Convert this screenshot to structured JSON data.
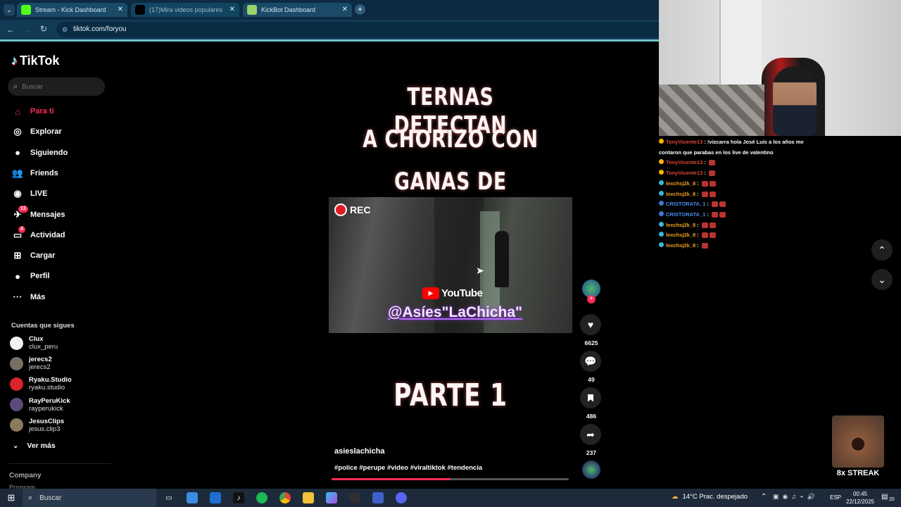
{
  "browser": {
    "tabs": [
      {
        "label": "Stream - Kick Dashboard",
        "fav_color": "#53fc18",
        "active": false
      },
      {
        "label": "(17)Mira videos populares",
        "fav_color": "#000000",
        "active": true
      },
      {
        "label": "KickBot Dashboard",
        "fav_color": "#9ad36a",
        "active": false
      }
    ],
    "url": "tiktok.com/foryou",
    "new_tab_symbol": "+"
  },
  "tiktok": {
    "logo": "TikTok",
    "search_placeholder": "Buscar",
    "nav": [
      {
        "label": "Para ti",
        "icon": "home-icon",
        "active": true
      },
      {
        "label": "Explorar",
        "icon": "compass-icon"
      },
      {
        "label": "Siguiendo",
        "icon": "following-avatar-icon"
      },
      {
        "label": "Friends",
        "icon": "friends-icon"
      },
      {
        "label": "LIVE",
        "icon": "live-icon"
      },
      {
        "label": "Mensajes",
        "icon": "messages-icon",
        "badge": "13"
      },
      {
        "label": "Actividad",
        "icon": "activity-icon",
        "badge": "4"
      },
      {
        "label": "Cargar",
        "icon": "upload-icon"
      },
      {
        "label": "Perfil",
        "icon": "profile-icon"
      },
      {
        "label": "Más",
        "icon": "more-icon"
      }
    ],
    "following_header": "Cuentas que sigues",
    "following": [
      {
        "name": "Clux",
        "handle": "clux_peru",
        "color": "#f2f2f2"
      },
      {
        "name": "jerecs2",
        "handle": "jerecs2",
        "color": "#7a6e62"
      },
      {
        "name": "Ryaku.Studio",
        "handle": "ryaku.studio",
        "color": "#d9222a"
      },
      {
        "name": "RayPeruKick",
        "handle": "rayperukick",
        "color": "#5b4a7a"
      },
      {
        "name": "JesusClips",
        "handle": "jesus.clip3",
        "color": "#8a7a5e"
      }
    ],
    "see_more": "Ver más",
    "footer_company": "Company",
    "footer_program": "Program"
  },
  "video": {
    "title_lines": [
      "TERNAS DETECTAN",
      "A CHORIZO CON",
      "GANAS DE CHOREAR"
    ],
    "rec_label": "REC",
    "youtube_label": "YouTube",
    "channel_handle": "@Asíes\"LaChicha\"",
    "part_label": "PARTE 1",
    "author": "asieslachicha",
    "hashtags": "#police #perupe #video #viraltiktok #tendencia",
    "progress": 0.5,
    "likes": "6625",
    "comments": "49",
    "saves": "486",
    "shares": "237"
  },
  "chat": [
    {
      "user": "TonyVicente13",
      "color": "#e0443a",
      "badge": "#ffb400",
      "msg": "!vizcarra hola José Luis a los años me"
    },
    {
      "user": "",
      "color": "#fff",
      "badge": "",
      "msg": "contaron que parabas en los live de valentino"
    },
    {
      "user": "TonyVicente13",
      "color": "#e0443a",
      "badge": "#ffb400",
      "msg": ""
    },
    {
      "user": "TonyVicente13",
      "color": "#e0443a",
      "badge": "#ffb400",
      "msg": ""
    },
    {
      "user": "lexchsj2k_8",
      "color": "#f0a020",
      "badge": "#3ab8d6",
      "msg": ""
    },
    {
      "user": "lexchsj2k_8",
      "color": "#f0a020",
      "badge": "#3ab8d6",
      "msg": ""
    },
    {
      "user": "CRISTORATA_1",
      "color": "#4a8cf0",
      "badge": "#3a7ad6",
      "msg": ""
    },
    {
      "user": "CRISTORATA_1",
      "color": "#4a8cf0",
      "badge": "#3a7ad6",
      "msg": ""
    },
    {
      "user": "lexchsj2k_8",
      "color": "#f0a020",
      "badge": "#3ab8d6",
      "msg": ""
    },
    {
      "user": "lexchsj2k_8",
      "color": "#f0a020",
      "badge": "#3ab8d6",
      "msg": ""
    },
    {
      "user": "lexchsj2k_8",
      "color": "#f0a020",
      "badge": "#3ab8d6",
      "msg": ""
    }
  ],
  "streak": {
    "label": "8x STREAK"
  },
  "taskbar": {
    "search_label": "Buscar",
    "weather": "14°C  Prac. despejado",
    "lang": "ESP",
    "time": "00:45",
    "date": "22/12/2025",
    "notif": "20"
  }
}
